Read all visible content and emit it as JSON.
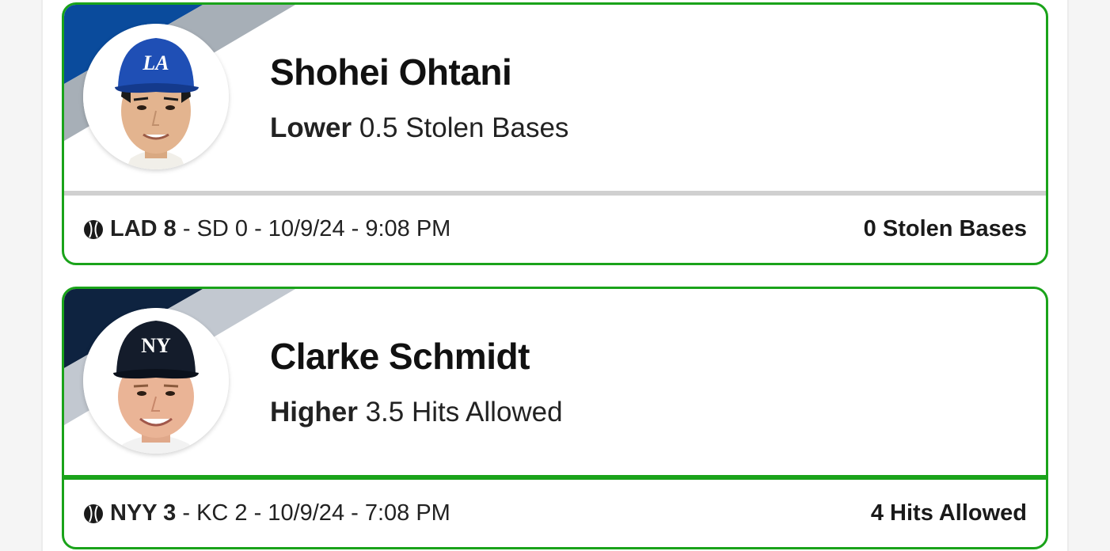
{
  "picks": [
    {
      "player_name": "Shohei Ohtani",
      "direction": "Lower",
      "line": "0.5 Stolen Bases",
      "team_primary": "#0a4b9c",
      "team_secondary": "#a7afb7",
      "cap_color": "#1f4fb5",
      "cap_logo": "LA",
      "game": {
        "winner": "LAD 8",
        "rest": " - SD 0 - 10/9/24 - 9:08 PM"
      },
      "result": "0 Stolen Bases",
      "divider_color": "#d0d0d0"
    },
    {
      "player_name": "Clarke Schmidt",
      "direction": "Higher",
      "line": "3.5 Hits Allowed",
      "team_primary": "#0e2340",
      "team_secondary": "#c2c8d0",
      "cap_color": "#141c2b",
      "cap_logo": "NY",
      "game": {
        "winner": "NYY 3",
        "rest": " - KC 2 - 10/9/24 - 7:08 PM"
      },
      "result": "4 Hits Allowed",
      "divider_color": "#1aa31a"
    }
  ],
  "colors": {
    "card_border": "#1aa31a"
  },
  "icons": {
    "sport": "baseball-icon"
  }
}
